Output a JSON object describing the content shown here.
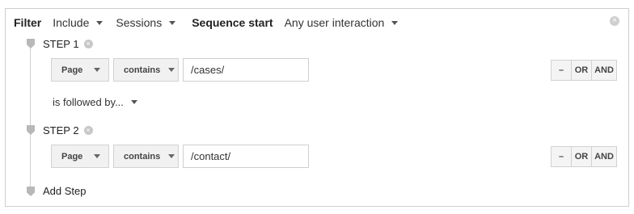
{
  "header": {
    "filter_label": "Filter",
    "include_value": "Include",
    "scope_value": "Sessions",
    "sequence_label": "Sequence start",
    "sequence_value": "Any user interaction",
    "clear_glyph": "×"
  },
  "steps": [
    {
      "label": "STEP 1",
      "dimension": "Page",
      "match": "contains",
      "value": "/cases/",
      "ops": [
        "–",
        "OR",
        "AND"
      ]
    },
    {
      "label": "STEP 2",
      "dimension": "Page",
      "match": "contains",
      "value": "/contact/",
      "ops": [
        "–",
        "OR",
        "AND"
      ]
    }
  ],
  "followed_by": "is followed by...",
  "add_step": "Add Step",
  "remove_step_glyph": "×"
}
